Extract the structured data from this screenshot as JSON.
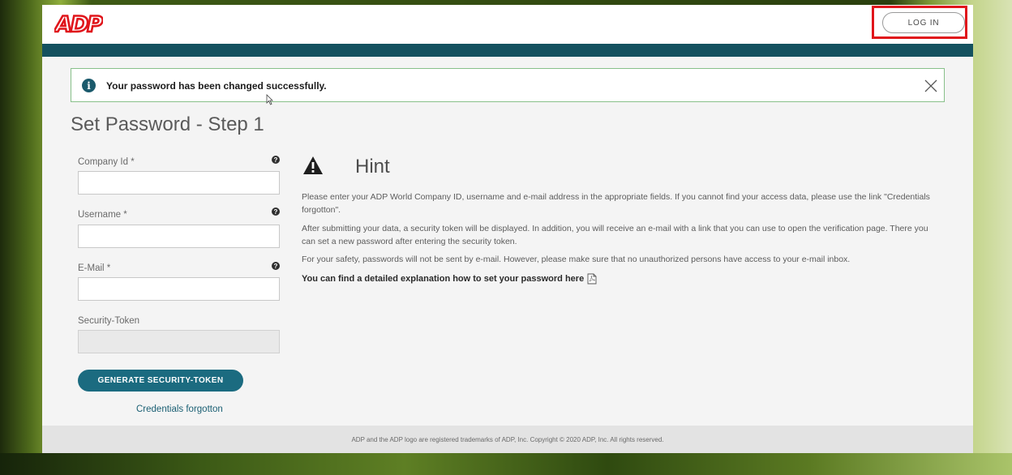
{
  "header": {
    "logo_text": "ADP",
    "login_label": "LOG IN",
    "brand_color": "#e0151b",
    "bar_color": "#14515f"
  },
  "alert": {
    "icon": "info-icon",
    "message": "Your password has been changed successfully.",
    "close_icon": "close-icon"
  },
  "page_title": "Set Password - Step 1",
  "form": {
    "company_id": {
      "label": "Company Id *",
      "value": ""
    },
    "username": {
      "label": "Username *",
      "value": ""
    },
    "email": {
      "label": "E-Mail *",
      "value": ""
    },
    "security_token": {
      "label": "Security-Token",
      "value": ""
    },
    "help_icon": "question-icon",
    "generate_label": "GENERATE SECURITY-TOKEN",
    "credentials_link": "Credentials forgotton"
  },
  "hint": {
    "icon": "warning-icon",
    "title": "Hint",
    "para1": "Please enter your ADP World Company ID, username and e-mail address in the appropriate fields. If you cannot find your access data, please use the link \"Credentials forgotton\".",
    "para2": "After submitting your data, a security token will be displayed. In addition, you will receive an e-mail with a link that you can use to open the verification page. There you can set a new password after entering the security token.",
    "para3": "For your safety, passwords will not be sent by e-mail. However, please make sure that no unauthorized persons have access to your e-mail inbox.",
    "link": "You can find a detailed explanation how to set your password here",
    "link_icon": "pdf-icon"
  },
  "footer": {
    "text": "ADP and the ADP logo are registered trademarks of ADP, Inc. Copyright © 2020 ADP, Inc. All rights reserved."
  }
}
